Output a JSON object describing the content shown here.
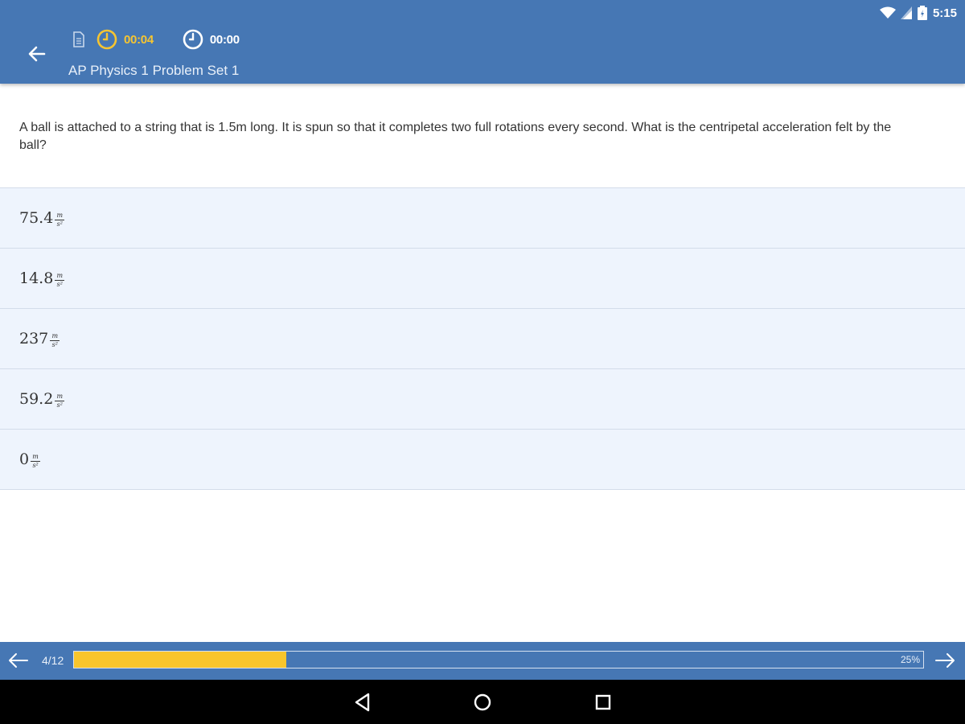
{
  "status_bar": {
    "time": "5:15",
    "icons": [
      "wifi-icon",
      "signal-icon",
      "battery-icon"
    ]
  },
  "header": {
    "back_icon": "arrow-left-icon",
    "doc_icon": "document-icon",
    "active_timer": "00:04",
    "total_timer": "00:00",
    "title": "AP Physics 1 Problem Set 1",
    "colors": {
      "background": "#4677b4",
      "accent": "#f6c531"
    }
  },
  "question": {
    "text": "A ball is attached to a string that is 1.5m long. It is spun so that it completes two full rotations every second. What is the centripetal acceleration felt by the ball?"
  },
  "answers": [
    {
      "value": "75.4",
      "unit_num": "m",
      "unit_den": "s²"
    },
    {
      "value": "14.8",
      "unit_num": "m",
      "unit_den": "s²"
    },
    {
      "value": "237",
      "unit_num": "m",
      "unit_den": "s²"
    },
    {
      "value": "59.2",
      "unit_num": "m",
      "unit_den": "s²"
    },
    {
      "value": "0",
      "unit_num": "m",
      "unit_den": "s²"
    }
  ],
  "progress": {
    "counter": "4/12",
    "percent_label": "25%",
    "fraction": 0.25,
    "colors": {
      "fill": "#f8c52c",
      "track": "#4677b4"
    }
  },
  "nav_bar": {
    "buttons": [
      "back-triangle-icon",
      "home-circle-icon",
      "recents-square-icon"
    ]
  }
}
